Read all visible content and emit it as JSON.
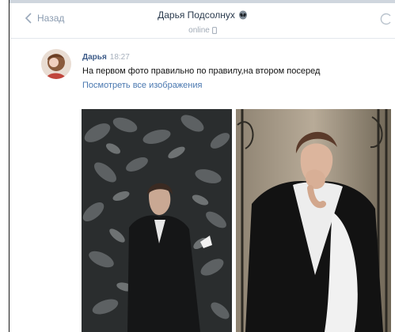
{
  "header": {
    "back_label": "Назад",
    "contact_name": "Дарья Подсолнух",
    "status": "online"
  },
  "message": {
    "author": "Дарья",
    "time": "18:27",
    "text": "На первом фото правильно по правилу,на втором посеред",
    "link": "Посмотреть все изображения"
  },
  "icons": {
    "back": "chevron-left-icon",
    "status_emoji": "alien-emoji-icon",
    "device": "mobile-phone-icon"
  },
  "colors": {
    "link": "#4a78b0",
    "author": "#3f5d8a",
    "muted": "#a7b1bd"
  }
}
